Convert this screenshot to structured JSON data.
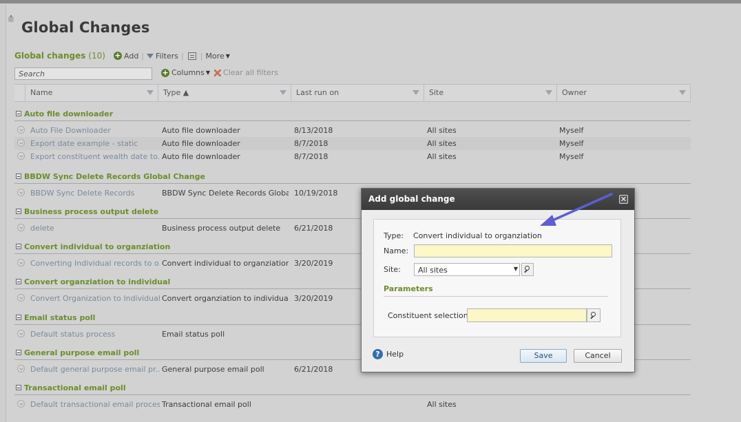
{
  "page": {
    "title": "Global Changes"
  },
  "toolbar": {
    "list_title": "Global changes",
    "count": "(10)",
    "add_label": "Add",
    "filters_label": "Filters",
    "more_label": "More",
    "columns_label": "Columns",
    "clear_filters_label": "Clear all filters"
  },
  "search": {
    "placeholder": "Search"
  },
  "columns": [
    "Name",
    "Type ▲",
    "Last run on",
    "Site",
    "Owner"
  ],
  "groups": [
    {
      "label": "Auto file downloader",
      "rows": [
        {
          "name": "Auto File Downloader",
          "type": "Auto file downloader",
          "last_run": "8/13/2018",
          "site": "All sites",
          "owner": "Myself"
        },
        {
          "name": "Export date example - static",
          "type": "Auto file downloader",
          "last_run": "8/7/2018",
          "site": "All sites",
          "owner": "Myself"
        },
        {
          "name": "Export constituent wealth date to...",
          "type": "Auto file downloader",
          "last_run": "8/7/2018",
          "site": "All sites",
          "owner": "Myself"
        }
      ]
    },
    {
      "label": "BBDW Sync Delete Records Global Change",
      "rows": [
        {
          "name": "BBDW Sync Delete Records",
          "type": "BBDW Sync Delete Records Global...",
          "last_run": "10/19/2018",
          "site": "",
          "owner": ""
        }
      ]
    },
    {
      "label": "Business process output delete",
      "rows": [
        {
          "name": "delete",
          "type": "Business process output delete",
          "last_run": "6/21/2018",
          "site": "",
          "owner": ""
        }
      ]
    },
    {
      "label": "Convert individual to organziation",
      "rows": [
        {
          "name": "Converting Individual records to o...",
          "type": "Convert individual to organziation",
          "last_run": "3/20/2019",
          "site": "",
          "owner": ""
        }
      ]
    },
    {
      "label": "Convert organziation to individual",
      "rows": [
        {
          "name": "Convert Organization to Individual",
          "type": "Convert organziation to individual",
          "last_run": "3/20/2019",
          "site": "",
          "owner": ""
        }
      ]
    },
    {
      "label": "Email status poll",
      "rows": [
        {
          "name": "Default status process",
          "type": "Email status poll",
          "last_run": "",
          "site": "",
          "owner": ""
        }
      ]
    },
    {
      "label": "General purpose email poll",
      "rows": [
        {
          "name": "Default general purpose email pr...",
          "type": "General purpose email poll",
          "last_run": "6/21/2018",
          "site": "",
          "owner": ""
        }
      ]
    },
    {
      "label": "Transactional email poll",
      "rows": [
        {
          "name": "Default transactional email process",
          "type": "Transactional email poll",
          "last_run": "",
          "site": "All sites",
          "owner": ""
        }
      ]
    }
  ],
  "dialog": {
    "title": "Add global change",
    "close_glyph": "✕",
    "type_label": "Type:",
    "type_value": "Convert individual to organziation",
    "name_label": "Name:",
    "name_value": "",
    "site_label": "Site:",
    "site_value": "All sites",
    "parameters_label": "Parameters",
    "constituent_label": "Constituent selection:",
    "constituent_value": "",
    "help_label": "Help",
    "save_label": "Save",
    "cancel_label": "Cancel"
  },
  "colors": {
    "accent_green": "#6c8d2c",
    "arrow": "#5b5fd6",
    "dialog_header": "#424242"
  }
}
